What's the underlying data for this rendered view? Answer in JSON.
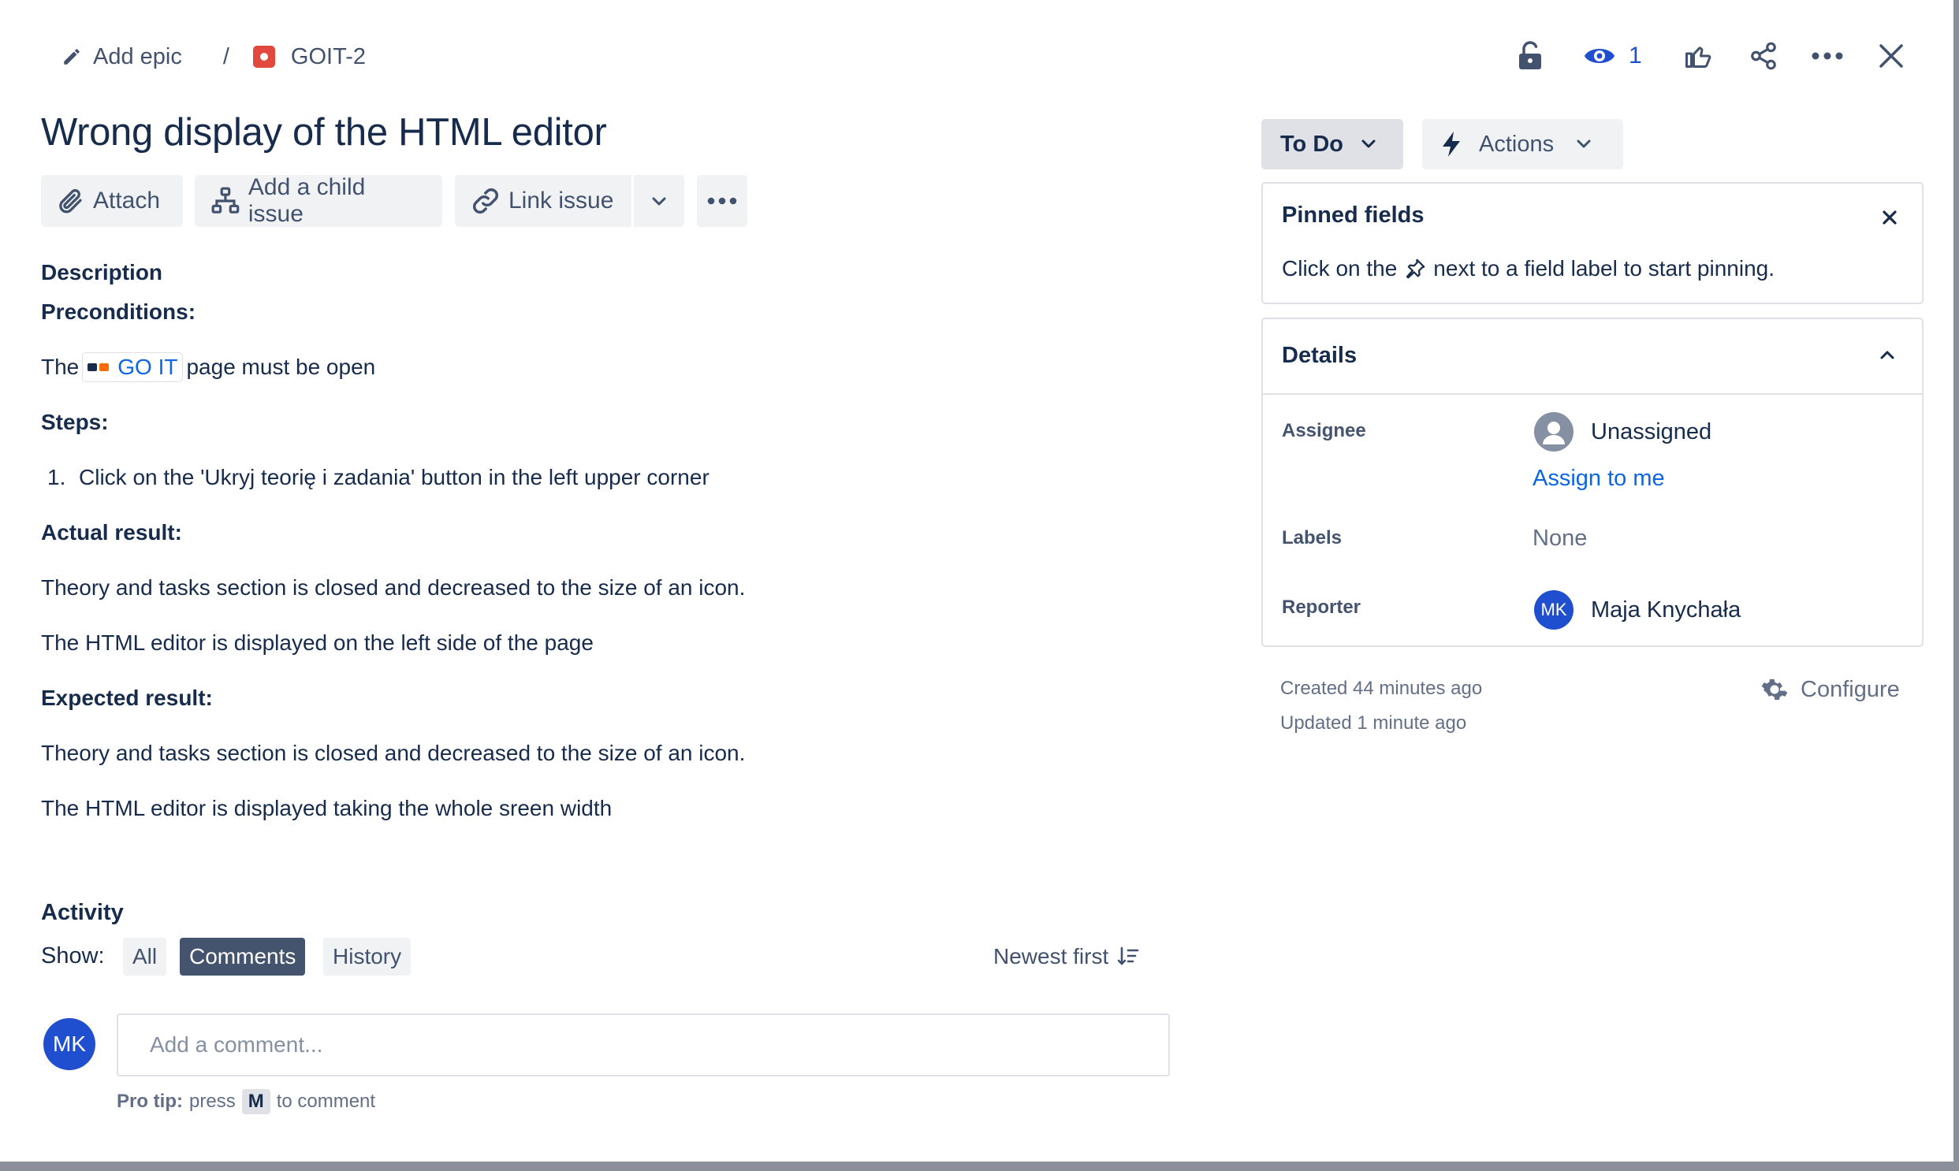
{
  "breadcrumb": {
    "add_epic": "Add epic",
    "separator": "/",
    "issue_key": "GOIT-2"
  },
  "header": {
    "watch_count": "1"
  },
  "issue": {
    "title": "Wrong display of the HTML editor"
  },
  "toolbar": {
    "attach": "Attach",
    "add_child": "Add a child issue",
    "link_issue": "Link issue"
  },
  "description": {
    "heading": "Description",
    "preconditions_heading": "Preconditions:",
    "pre_text_before": "The",
    "smart_link": "GO IT",
    "pre_text_after": "page must be open",
    "steps_heading": "Steps:",
    "steps": [
      {
        "num": "1.",
        "text": "Click on the 'Ukryj teorię i zadania' button in the left upper corner"
      }
    ],
    "actual_heading": "Actual result:",
    "actual_1": "Theory and tasks section is closed and decreased to the size of an icon.",
    "actual_2": "The HTML editor is displayed on the left side of the page",
    "expected_heading": "Expected result:",
    "expected_1": "Theory and tasks section is closed and decreased to the size of an icon.",
    "expected_2": "The HTML editor is displayed taking the whole sreen width"
  },
  "activity": {
    "heading": "Activity",
    "show_label": "Show:",
    "filters": [
      "All",
      "Comments",
      "History"
    ],
    "active_filter": "Comments",
    "sort_label": "Newest first",
    "comment_placeholder": "Add a comment...",
    "user_initials": "MK",
    "pro_tip_bold": "Pro tip:",
    "pro_tip_press": "press",
    "pro_tip_key": "M",
    "pro_tip_after": "to comment"
  },
  "status": {
    "current": "To Do",
    "actions": "Actions"
  },
  "pinned": {
    "heading": "Pinned fields",
    "hint_before": "Click on the",
    "hint_after": "next to a field label to start pinning."
  },
  "details": {
    "heading": "Details",
    "assignee_label": "Assignee",
    "assignee_value": "Unassigned",
    "assign_to_me": "Assign to me",
    "labels_label": "Labels",
    "labels_value": "None",
    "reporter_label": "Reporter",
    "reporter_initials": "MK",
    "reporter_name": "Maja Knychała"
  },
  "meta": {
    "created": "Created 44 minutes ago",
    "updated": "Updated 1 minute ago",
    "configure": "Configure"
  },
  "colors": {
    "brand_blue": "#0c66e4",
    "avatar_blue": "#1f4fcf",
    "text_primary": "#172b4d",
    "text_subtle": "#42526e",
    "issue_type_red": "#e2483d",
    "active_filter_bg": "#44546f"
  }
}
